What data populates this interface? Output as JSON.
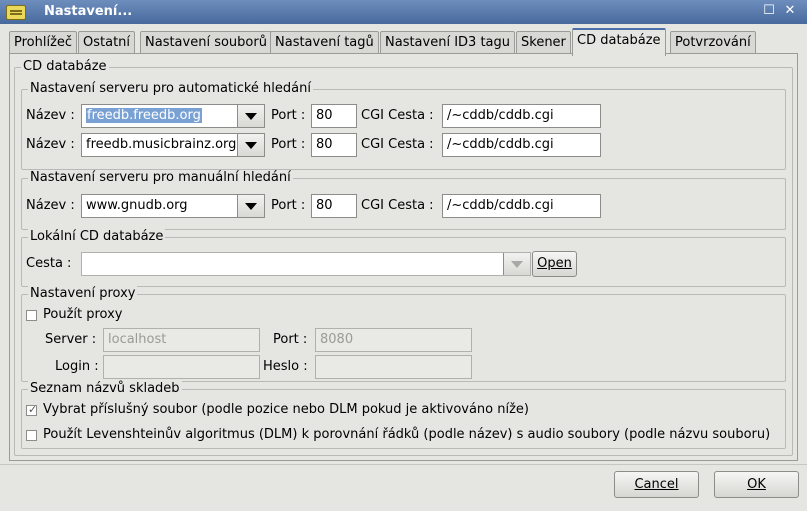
{
  "window": {
    "title": "Nastavení..."
  },
  "tabs": [
    {
      "label": "Prohlížeč"
    },
    {
      "label": "Ostatní"
    },
    {
      "label": "Nastavení souborů"
    },
    {
      "label": "Nastavení tagů"
    },
    {
      "label": "Nastavení ID3 tagu"
    },
    {
      "label": "Skener"
    },
    {
      "label": "CD databáze",
      "active": true
    },
    {
      "label": "Potvrzování"
    }
  ],
  "page_title": "CD databáze",
  "auto_group": {
    "title": "Nastavení serveru pro automatické hledání",
    "rows": [
      {
        "name_label": "Název :",
        "name_value": "freedb.freedb.org",
        "port_label": "Port :",
        "port_value": "80",
        "cgi_label": "CGI Cesta :",
        "cgi_value": "/~cddb/cddb.cgi"
      },
      {
        "name_label": "Název :",
        "name_value": "freedb.musicbrainz.org",
        "port_label": "Port :",
        "port_value": "80",
        "cgi_label": "CGI Cesta :",
        "cgi_value": "/~cddb/cddb.cgi"
      }
    ]
  },
  "manual_group": {
    "title": "Nastavení serveru pro manuální hledání",
    "row": {
      "name_label": "Název :",
      "name_value": "www.gnudb.org",
      "port_label": "Port :",
      "port_value": "80",
      "cgi_label": "CGI Cesta :",
      "cgi_value": "/~cddb/cddb.cgi"
    }
  },
  "local_group": {
    "title": "Lokální CD databáze",
    "path_label": "Cesta :",
    "path_value": "",
    "open_label": "Open"
  },
  "proxy_group": {
    "title": "Nastavení proxy",
    "use_proxy_label": "Použít proxy",
    "use_proxy_checked": false,
    "server_label": "Server :",
    "server_value": "localhost",
    "port_label": "Port :",
    "port_value": "8080",
    "login_label": "Login :",
    "login_value": "",
    "password_label": "Heslo :",
    "password_value": ""
  },
  "tracklist_group": {
    "title": "Seznam názvů skladeb",
    "option1_label": "Vybrat příslušný soubor (podle pozice nebo DLM pokud je aktivováno níže)",
    "option1_checked": true,
    "option2_label": "Použít Levenshteinův algoritmus (DLM) k porovnání řádků (podle název) s audio soubory (podle názvu souboru)",
    "option2_checked": false
  },
  "buttons": {
    "cancel": "Cancel",
    "ok": "OK"
  }
}
